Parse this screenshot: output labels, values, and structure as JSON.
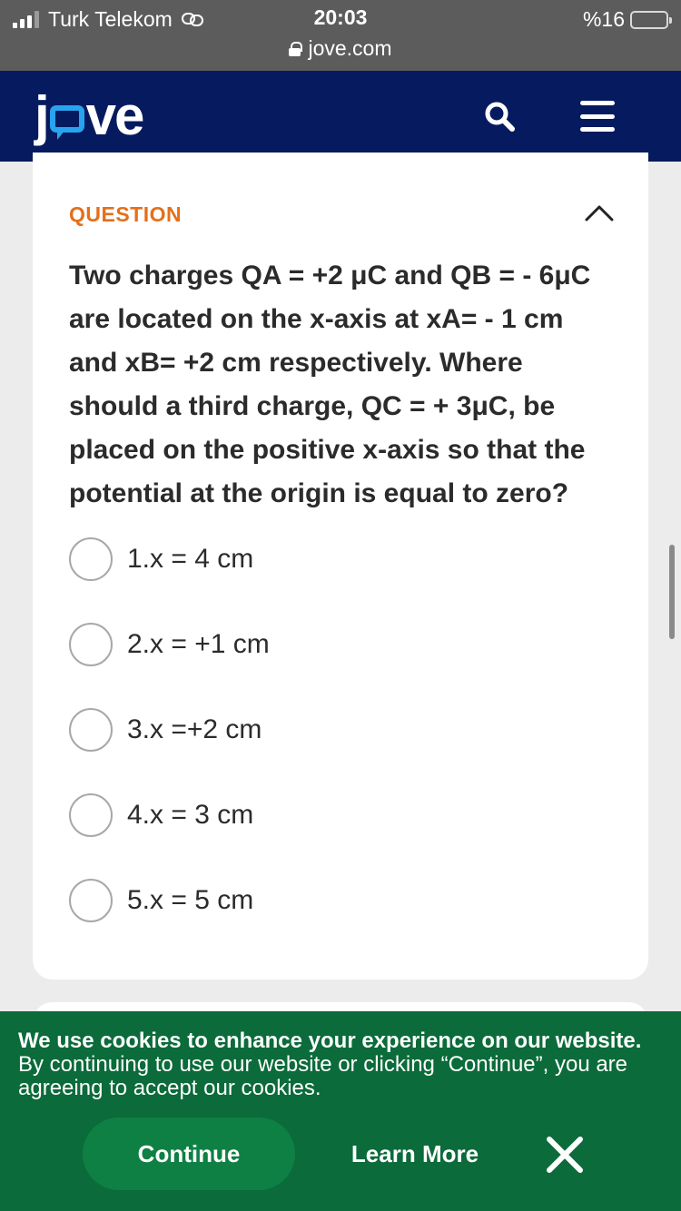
{
  "status_bar": {
    "carrier": "Turk Telekom",
    "time": "20:03",
    "url": "jove.com",
    "battery": "%16",
    "battery_level": 0.16,
    "signal_bars_active": 3
  },
  "header": {
    "logo_j": "j",
    "logo_ve": "ve",
    "icons": [
      "search-icon",
      "hamburger-menu-icon"
    ]
  },
  "question": {
    "label": "QUESTION",
    "text": "Two charges QA = +2 μC and QB = - 6μC are located on the x-axis at xA= - 1 cm and xB= +2 cm respectively. Where should a third charge, QC = + 3μC, be placed on the positive x-axis so that the potential at the origin is equal to zero?",
    "options": [
      "1.x = 4 cm",
      "2.x = +1 cm",
      "3.x =+2 cm",
      "4.x = 3 cm",
      "5.x = 5 cm"
    ]
  },
  "cookie_banner": {
    "title": "We use cookies to enhance your experience on our website.",
    "body": "By continuing to use our website or clicking “Continue”, you are agreeing to accept our cookies.",
    "continue_label": "Continue",
    "learn_more_label": "Learn More"
  },
  "colors": {
    "nav_bg": "#061b5f",
    "accent_orange": "#e46f1b",
    "cookie_bg": "#0b6b3a",
    "continue_bg": "#0f8044",
    "logo_bubble": "#2aa3ee"
  }
}
